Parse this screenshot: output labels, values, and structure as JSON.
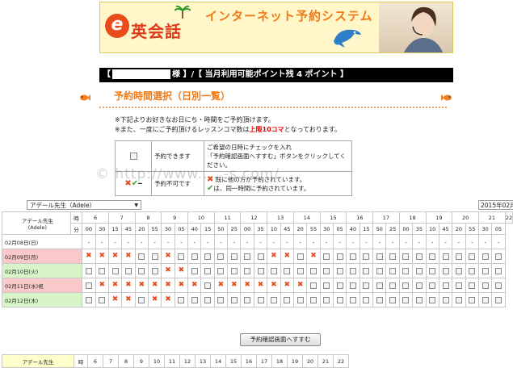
{
  "banner": {
    "logo_letter": "e",
    "logo_text": "英会話",
    "system_title": "インターネット予約システム"
  },
  "infobar": {
    "prefix": "【",
    "suffix": "様 】/【 当月利用可能ポイント残 4 ポイント 】"
  },
  "section": {
    "title": "予約時間選択（日別一覧）"
  },
  "notes": {
    "line1": "※下記よりお好きなお日にち・時間をご予約頂けます。",
    "line2_before": "※また、一度にご予約頂けるレッスンコマ数は",
    "line2_red": "上限10コマ",
    "line2_after": "となっております。"
  },
  "legend": {
    "available_label": "予約できます",
    "available_desc_1": "ご希望の日時にチェックを入れ",
    "available_desc_2": "「予約確認画面へすすむ」ボタンをクリックしてください。",
    "unavailable_label": "予約不可です",
    "unavailable_desc_1": "既に他の方が予約されています。",
    "unavailable_desc_2": "は、同一時間に予約されています。"
  },
  "teacher_select": {
    "value": "アデール先生（Adele）"
  },
  "year_label": "2015年02月",
  "grid": {
    "teacher_name": "アデール先生",
    "teacher_roman": "(Adele)",
    "hour_label": "時",
    "minute_label": "分",
    "hours": [
      "6",
      "7",
      "8",
      "9",
      "10",
      "11",
      "12",
      "13",
      "14",
      "15",
      "16",
      "17",
      "18",
      "19",
      "20",
      "21",
      "22"
    ],
    "minutes": [
      "00",
      "30",
      "15",
      "45",
      "20",
      "55",
      "30",
      "05",
      "40",
      "15",
      "50",
      "25",
      "00",
      "35",
      "10",
      "45",
      "20",
      "55",
      "30",
      "05",
      "40",
      "15",
      "50",
      "25",
      "00",
      "35",
      "10",
      "45",
      "20",
      "55",
      "30",
      "05"
    ],
    "days": [
      {
        "label": "02月08日(日)",
        "type": "none",
        "cells": "--------------------------------"
      },
      {
        "label": "02月09日(月)",
        "type": "pink",
        "cells": "XXXXccXcccccccXXcXcccccccccccccc"
      },
      {
        "label": "02月10日(火)",
        "type": "green",
        "cells": "ccccccXXcccccccccccccccccccccccc"
      },
      {
        "label": "02月11日(水)祝",
        "type": "pink",
        "cells": "cXXXXXXXXcXXXXXXXccccccccccccccc"
      },
      {
        "label": "02月12日(木)",
        "type": "green",
        "cells": "ccXXcXXcccccccccccccccccccccccc"
      }
    ]
  },
  "confirm_button": "予約確認画面へすすむ",
  "watermark": "© http://www.... -s.com/"
}
